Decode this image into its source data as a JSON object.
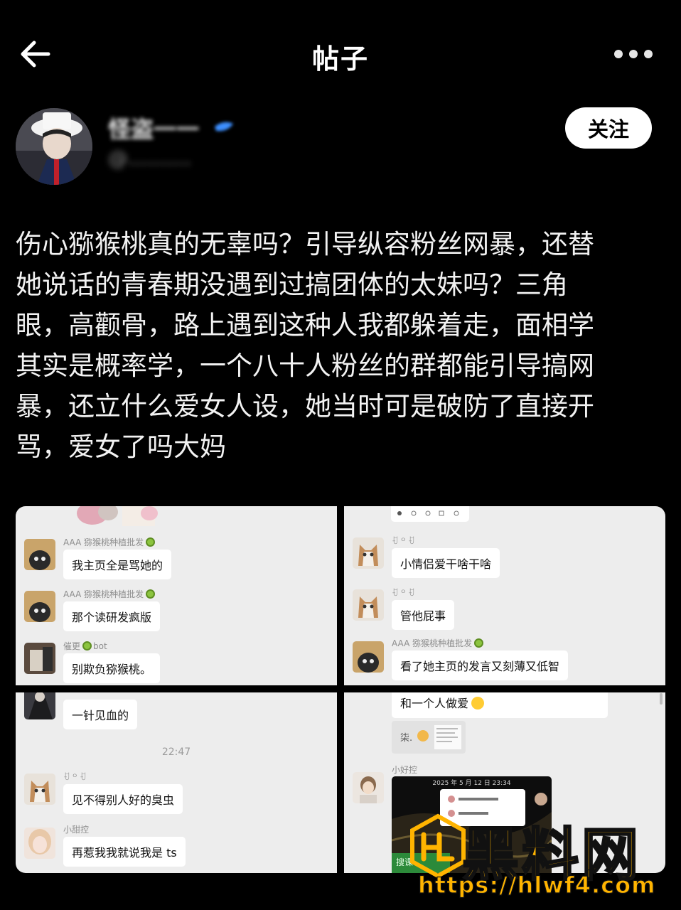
{
  "header": {
    "title": "帖子",
    "back_icon": "arrow-left-icon",
    "more_icon": "more-horizontal-icon"
  },
  "author": {
    "name": "怪盗一一",
    "handle": "@..........",
    "follow_label": "关注"
  },
  "post": {
    "lines": [
      "伤心猕猴桃真的无辜吗？引导纵容粉丝网暴，还替",
      "她说话的青春期没遇到过搞团体的太妹吗？三角",
      "眼，高颧骨，路上遇到这种人我都躲着走，面相学",
      "其实是概率学，一个八十人粉丝的群都能引导搞网",
      "暴，还立什么爱女人设，她当时可是破防了直接开",
      "骂，爱女了吗大妈"
    ]
  },
  "screenshots": {
    "s1": {
      "messages": [
        {
          "sender": "AAA 猕猴桃种植批发",
          "text": "我主页全是骂她的"
        },
        {
          "sender": "AAA 猕猴桃种植批发",
          "text": "那个读研发疯版"
        },
        {
          "sender": "催更",
          "sender_suffix": "bot",
          "text": "别欺负猕猴桃。"
        }
      ]
    },
    "s2": {
      "messages": [
        {
          "sender": "ꀀ ᴼ ꀀ",
          "text": "小情侣爱干啥干啥"
        },
        {
          "sender": "ꀀ ᴼ ꀀ",
          "text": "管他屁事"
        },
        {
          "sender": "AAA 猕猴桃种植批发",
          "text": "看了她主页的发言又刻薄又低智"
        }
      ]
    },
    "s3": {
      "messages": [
        {
          "sender": "",
          "text": "一针见血的"
        },
        {
          "sender": "ꀀ ᴼ ꀀ",
          "text": "见不得别人好的臭虫"
        },
        {
          "sender": "小甜控",
          "text": "再惹我我就说我是 ts"
        }
      ],
      "time": "22:47"
    },
    "s4": {
      "top_text": "和一个人做爱",
      "quote_label": "柒.",
      "sender": "小好控",
      "video_time": "2025 年 5 月 12 日 23:34",
      "video_caption": "搜课"
    }
  },
  "watermark": {
    "name": "黑料网",
    "url": "https://hlwf4.com"
  },
  "colors": {
    "background": "#000000",
    "follow_bg": "#ffffff",
    "chat_bg": "#ededed",
    "watermark": "#ffb400"
  }
}
